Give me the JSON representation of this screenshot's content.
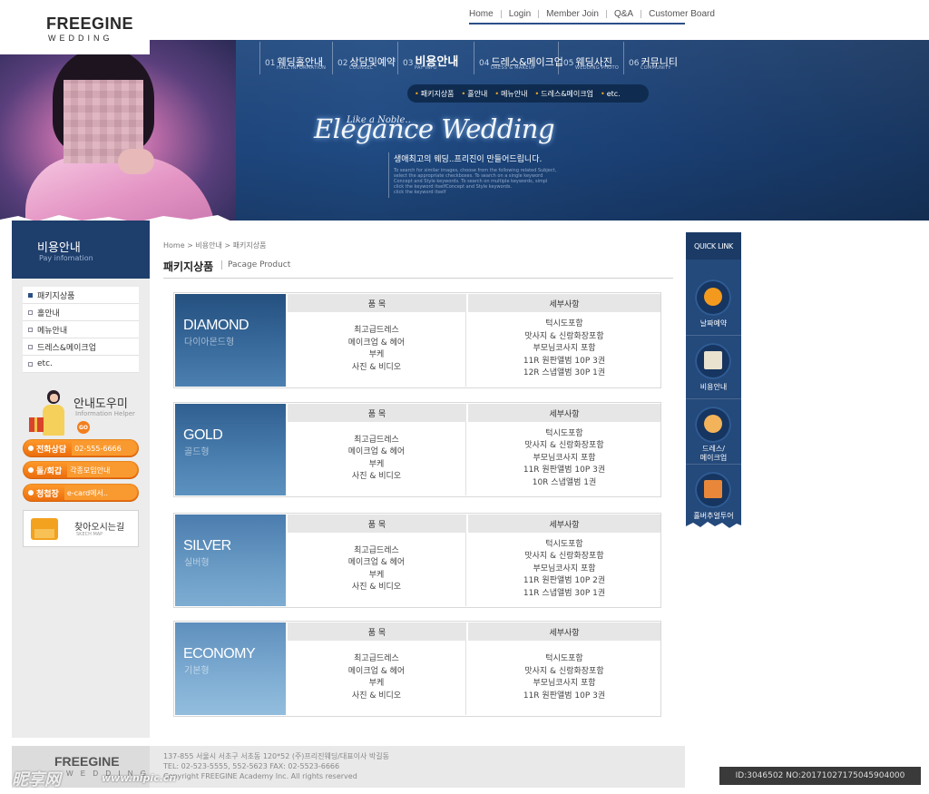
{
  "logo": {
    "main": "FREEGINE",
    "sub": "WEDDING"
  },
  "top_links": [
    "Home",
    "Login",
    "Member Join",
    "Q&A",
    "Customer Board"
  ],
  "gnb": [
    {
      "num": "01",
      "label": "웨딩홀안내",
      "en": "HALL INFORMATION"
    },
    {
      "num": "02",
      "label": "상담및예약",
      "en": "COUNSEL"
    },
    {
      "num": "03",
      "label": "비용안내",
      "en": "PAY INFO"
    },
    {
      "num": "04",
      "label": "드레스&메이크업",
      "en": "DRESS & MAKEUP"
    },
    {
      "num": "05",
      "label": "웨딩사진",
      "en": "WEDDING PHOTO"
    },
    {
      "num": "06",
      "label": "커뮤니티",
      "en": "COMMUNITY"
    }
  ],
  "subnav": [
    "패키지상품",
    "홀안내",
    "메뉴안내",
    "드레스&메이크업",
    "etc."
  ],
  "banner": {
    "title_small": "Like a Noble..",
    "title_script": "Elegance Wedding",
    "tagline": "생애최고의 웨딩..프리진이 만들어드립니다.",
    "small_text": [
      "To search for similar images, choose from the following related Subject,",
      "select the appropriate checkboxes. To search on a single keyword",
      "Concept and Style keywords. To search on multiple keywords, simpl",
      "click the keyword itselfConcept and Style keywords.",
      "click the keyword itself"
    ]
  },
  "sidebar": {
    "title": "비용안내",
    "title_en": "Pay infomation",
    "items": [
      "패키지상품",
      "홀안내",
      "메뉴안내",
      "드레스&메이크업",
      "etc."
    ],
    "helper_title": "안내도우미",
    "helper_en": "Information Helper",
    "helper_go": "GO",
    "pills": [
      {
        "a": "전화상담",
        "b": "02-555-6666"
      },
      {
        "a": "돌/회갑",
        "b": "각종모임안내"
      },
      {
        "a": "청첩장",
        "b": "e-card에서.."
      }
    ],
    "map_title": "찾아오시는길",
    "map_en": "SKECH MAP"
  },
  "content": {
    "breadcrumb": "Home > 비용안내 > 패키지상품",
    "title": "패키지상품",
    "title_en": "Pacage Product",
    "col1_header": "품 목",
    "col2_header": "세부사항",
    "packages": [
      {
        "name_en": "DIAMOND",
        "name_ko": "다이아몬드형",
        "items": [
          "최고급드레스",
          "메이크업 & 헤어",
          "부케",
          "사진 & 비디오"
        ],
        "details": [
          "턱시도포함",
          "맛사지 & 신랑화장포함",
          "부모님코사지 포함",
          "11R 원판앨범 10P 3권",
          "12R 스냅앨범 30P 1권"
        ]
      },
      {
        "name_en": "GOLD",
        "name_ko": "골드형",
        "items": [
          "최고급드레스",
          "메이크업 & 헤어",
          "부케",
          "사진 & 비디오"
        ],
        "details": [
          "턱시도포함",
          "맛사지 & 신랑화장포함",
          "부모님코사지 포함",
          "11R 원판앨범 10P 3권",
          "10R 스냅앨범 1권"
        ]
      },
      {
        "name_en": "SILVER",
        "name_ko": "실버형",
        "items": [
          "최고급드레스",
          "메이크업 & 헤어",
          "부케",
          "사진 & 비디오"
        ],
        "details": [
          "턱시도포함",
          "맛사지 & 신랑화장포함",
          "부모님코사지 포함",
          "11R 원판앨범 10P 2권",
          "11R 스냅앨범 30P 1권"
        ]
      },
      {
        "name_en": "ECONOMY",
        "name_ko": "기본형",
        "items": [
          "최고급드레스",
          "메이크업 & 헤어",
          "부케",
          "사진 & 비디오"
        ],
        "details": [
          "턱시도포함",
          "맛사지 & 신랑화장포함",
          "부모님코사지 포함",
          "11R 원판앨범 10P 3권"
        ]
      }
    ]
  },
  "quick_link": {
    "title": "QUICK LINK",
    "items": [
      {
        "label": "날짜예약",
        "icon": "clock-icon"
      },
      {
        "label": "비용안내",
        "icon": "card-icon"
      },
      {
        "label": "드레스/\n메이크업",
        "icon": "people-icon"
      },
      {
        "label": "홀버추얼투어",
        "icon": "house-icon"
      }
    ]
  },
  "footer": {
    "logo_main": "FREEGINE",
    "logo_sub": "W E D D I N G",
    "lines": [
      "137-855 서울시 서초구 서초동 120*52 (주)프리진웨딩/대표이사 박길동",
      "TEL: 02-523-5555, 552-5623    FAX: 02-5523-6666",
      "Copyright FREEGINE Academy Inc. All rights reserved"
    ]
  },
  "watermark": {
    "left": "昵享网",
    "left_url": "www.nipic.cn",
    "id": "ID:3046502 NO:20171027175045904000"
  },
  "colors": {
    "navy": "#1e3e6c",
    "accent_orange": "#f27e1c",
    "banner_blue": "#1f4a82"
  }
}
